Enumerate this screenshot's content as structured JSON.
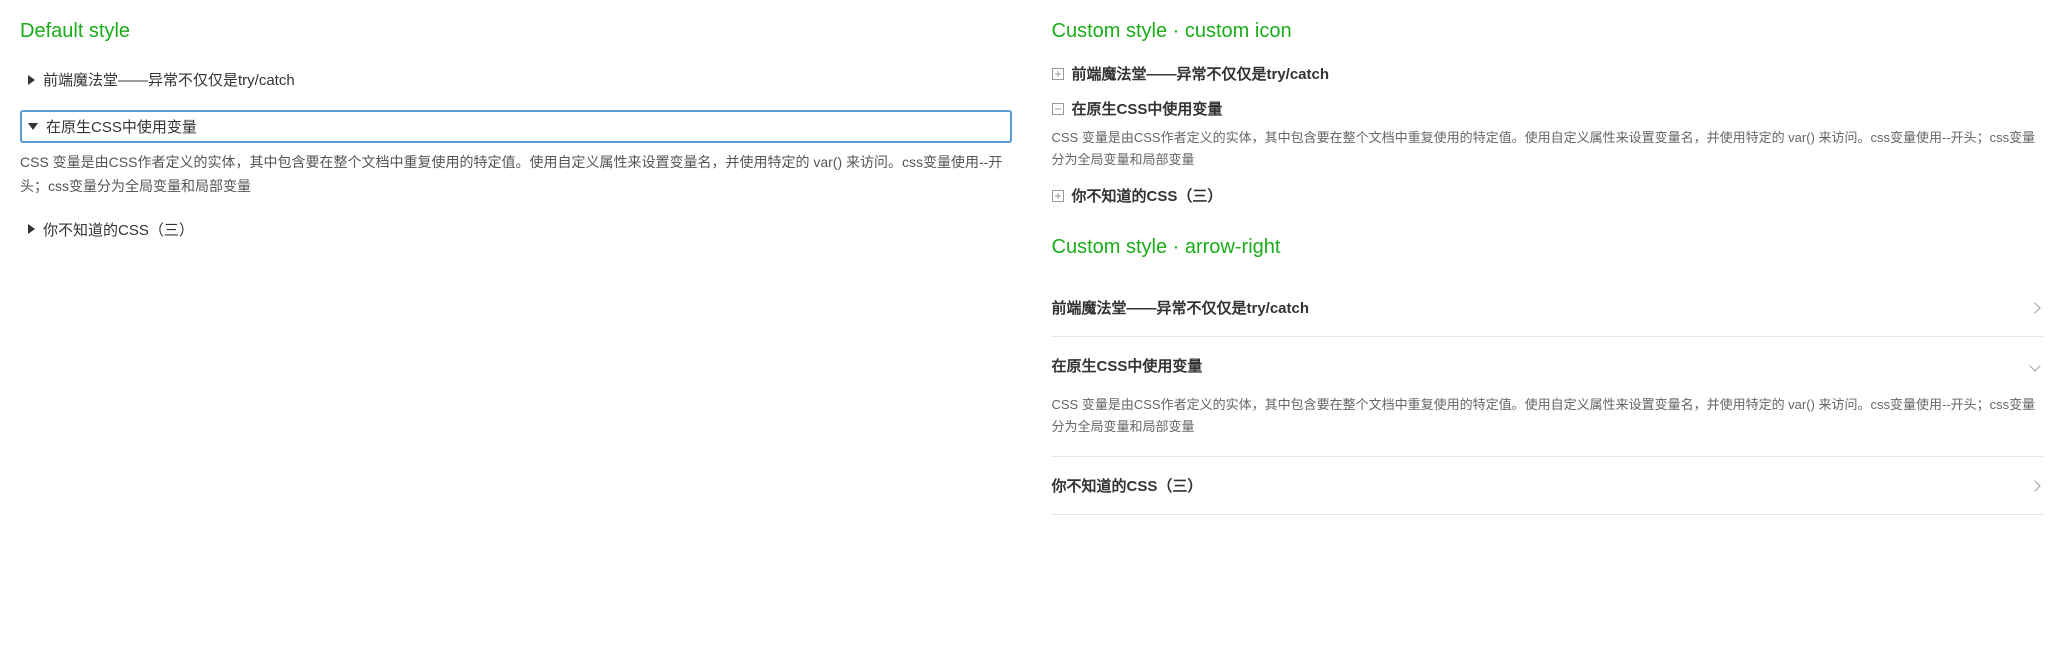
{
  "titles": {
    "default": "Default style",
    "custom_icon": "Custom style · custom icon",
    "arrow_right": "Custom style · arrow-right"
  },
  "items": {
    "item1": {
      "title": "前端魔法堂——异常不仅仅是try/catch"
    },
    "item2": {
      "title": "在原生CSS中使用变量",
      "content": "CSS 变量是由CSS作者定义的实体，其中包含要在整个文档中重复使用的特定值。使用自定义属性来设置变量名，并使用特定的 var() 来访问。css变量使用--开头；css变量分为全局变量和局部变量"
    },
    "item3": {
      "title": "你不知道的CSS（三）"
    }
  }
}
